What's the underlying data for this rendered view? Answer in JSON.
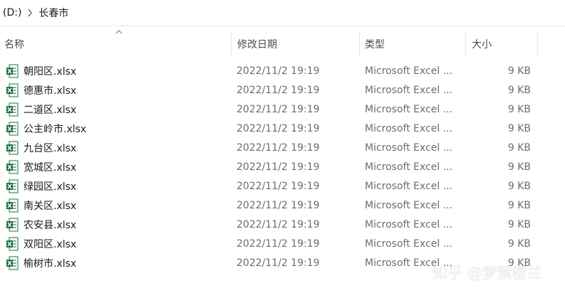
{
  "breadcrumb": {
    "items": [
      "(D:)",
      "长春市"
    ]
  },
  "columns": {
    "name": "名称",
    "modified": "修改日期",
    "type": "类型",
    "size": "大小"
  },
  "files": [
    {
      "name": "朝阳区.xlsx",
      "modified": "2022/11/2 19:19",
      "type": "Microsoft Excel ...",
      "size": "9 KB"
    },
    {
      "name": "德惠市.xlsx",
      "modified": "2022/11/2 19:19",
      "type": "Microsoft Excel ...",
      "size": "9 KB"
    },
    {
      "name": "二道区.xlsx",
      "modified": "2022/11/2 19:19",
      "type": "Microsoft Excel ...",
      "size": "9 KB"
    },
    {
      "name": "公主岭市.xlsx",
      "modified": "2022/11/2 19:19",
      "type": "Microsoft Excel ...",
      "size": "9 KB"
    },
    {
      "name": "九台区.xlsx",
      "modified": "2022/11/2 19:19",
      "type": "Microsoft Excel ...",
      "size": "9 KB"
    },
    {
      "name": "宽城区.xlsx",
      "modified": "2022/11/2 19:19",
      "type": "Microsoft Excel ...",
      "size": "9 KB"
    },
    {
      "name": "绿园区.xlsx",
      "modified": "2022/11/2 19:19",
      "type": "Microsoft Excel ...",
      "size": "9 KB"
    },
    {
      "name": "南关区.xlsx",
      "modified": "2022/11/2 19:19",
      "type": "Microsoft Excel ...",
      "size": "9 KB"
    },
    {
      "name": "农安县.xlsx",
      "modified": "2022/11/2 19:19",
      "type": "Microsoft Excel ...",
      "size": "9 KB"
    },
    {
      "name": "双阳区.xlsx",
      "modified": "2022/11/2 19:19",
      "type": "Microsoft Excel ...",
      "size": "9 KB"
    },
    {
      "name": "榆树市.xlsx",
      "modified": "2022/11/2 19:19",
      "type": "Microsoft Excel ...",
      "size": "9 KB"
    }
  ],
  "icons": {
    "file": "excel-file-icon",
    "separator": "chevron-right-icon",
    "sort": "sort-ascending-icon"
  },
  "colors": {
    "excel_green": "#1d6f42"
  },
  "watermark": "知乎 @梦萦楼兰"
}
